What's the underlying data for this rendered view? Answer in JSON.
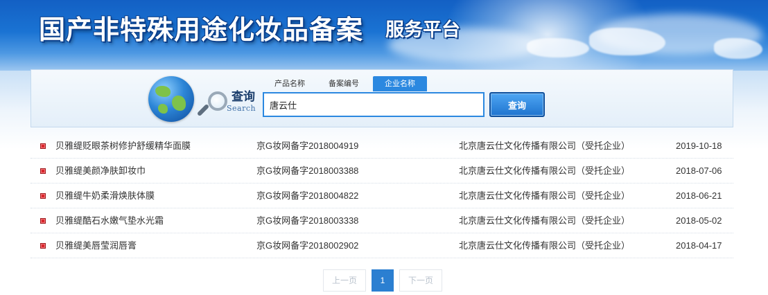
{
  "header": {
    "title": "国产非特殊用途化妆品备案",
    "subtitle": "服务平台"
  },
  "search": {
    "label_cn": "查询",
    "label_en": "Search",
    "tabs": [
      {
        "label": "产品名称",
        "active": false
      },
      {
        "label": "备案编号",
        "active": false
      },
      {
        "label": "企业名称",
        "active": true
      }
    ],
    "input_value": "唐云仕",
    "button_label": "查询"
  },
  "results": [
    {
      "name": "贝雅缇贬眼茶树修护舒缓精华面膜",
      "record_no": "京G妆网备字2018004919",
      "company": "北京唐云仕文化传播有限公司（受托企业）",
      "date": "2019-10-18"
    },
    {
      "name": "贝雅缇美颜净肤卸妆巾",
      "record_no": "京G妆网备字2018003388",
      "company": "北京唐云仕文化传播有限公司（受托企业）",
      "date": "2018-07-06"
    },
    {
      "name": "贝雅缇牛奶柔滑焕肤体膜",
      "record_no": "京G妆网备字2018004822",
      "company": "北京唐云仕文化传播有限公司（受托企业）",
      "date": "2018-06-21"
    },
    {
      "name": "贝雅缇酷石水嫩气垫水光霜",
      "record_no": "京G妆网备字2018003338",
      "company": "北京唐云仕文化传播有限公司（受托企业）",
      "date": "2018-05-02"
    },
    {
      "name": "贝雅缇美唇莹润唇膏",
      "record_no": "京G妆网备字2018002902",
      "company": "北京唐云仕文化传播有限公司（受托企业）",
      "date": "2018-04-17"
    }
  ],
  "pagination": {
    "prev": "上一页",
    "current": "1",
    "next": "下一页"
  }
}
